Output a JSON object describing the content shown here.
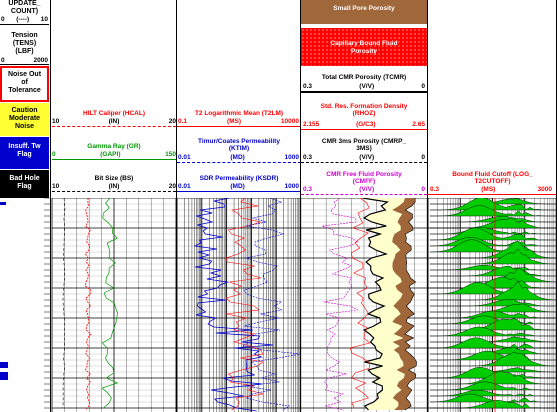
{
  "left_panel": {
    "update_count_title": "UPDATE_\nCOUNT)",
    "update_count_scale": {
      "left": "0",
      "mid": "(----)",
      "right": "10"
    },
    "tension_title": "Tension\n(TENS)\n(LBF)",
    "tension_scale": {
      "left": "0",
      "right": "2000"
    },
    "noise_flag": "Noise Out\nof\nTolerance",
    "caution_flag": "Caution\nModerate\nNoise",
    "insuff_flag": "Insuff. Tw\nFlag",
    "bad_hole_flag": "Bad Hole\nFlag"
  },
  "colors": {
    "red": "#ff0000",
    "green": "#009900",
    "blue": "#0000cc",
    "magenta": "#cc00cc",
    "brown": "#a0673a",
    "yellow": "#ffff33",
    "black": "#000000"
  },
  "legend_top": {
    "small_pore": "Small Pore Porosity",
    "capillary": "Capillary Bound Fluid\nPorosity"
  },
  "tracks": {
    "track1": {
      "hilt": {
        "title": "HILT Caliper (HCAL)",
        "left": "10",
        "unit": "(IN)",
        "right": "20"
      },
      "gamma": {
        "title": "Gamma Ray (GR)",
        "left": "0",
        "unit": "(GAPI)",
        "right": "150"
      },
      "bitsize": {
        "title": "Bit Size (BS)",
        "left": "10",
        "unit": "(IN)",
        "right": "20"
      }
    },
    "track2": {
      "t2lm": {
        "title": "T2 Logarithmic Mean (T2LM)",
        "left": "0.1",
        "unit": "(MS)",
        "right": "10000"
      },
      "ktim": {
        "title": "Timur/Coates Permeability\n(KTIM)",
        "left": "0.01",
        "unit": "(MD)",
        "right": "1000"
      },
      "ksdr": {
        "title": "SDR Permeability (KSDR)",
        "left": "0.01",
        "unit": "(MD)",
        "right": "1000"
      }
    },
    "track3": {
      "tcmr": {
        "title": "Total CMR Porosity (TCMR)",
        "left": "0.3",
        "unit": "(V/V)",
        "right": "0"
      },
      "rhoz": {
        "title": "Std. Res. Formation Density\n(RHOZ)",
        "left": "2.155",
        "unit": "(G/C3)",
        "right": "2.65"
      },
      "cmrp": {
        "title": "CMR 3ms Porosity (CMRP_\n3MS)",
        "left": "0.3",
        "unit": "(V/V)",
        "right": "0"
      },
      "cmff": {
        "title": "CMR Free Fluid Porosity\n(CMFF)",
        "left": "0.3",
        "unit": "(V/V)",
        "right": "0"
      }
    },
    "track4": {
      "cutoff": {
        "title": "Bound Fluid Cutoff (LOG_\nT2CUTOFF)",
        "left": "0.3",
        "unit": "(MS)",
        "right": "3000"
      }
    }
  }
}
